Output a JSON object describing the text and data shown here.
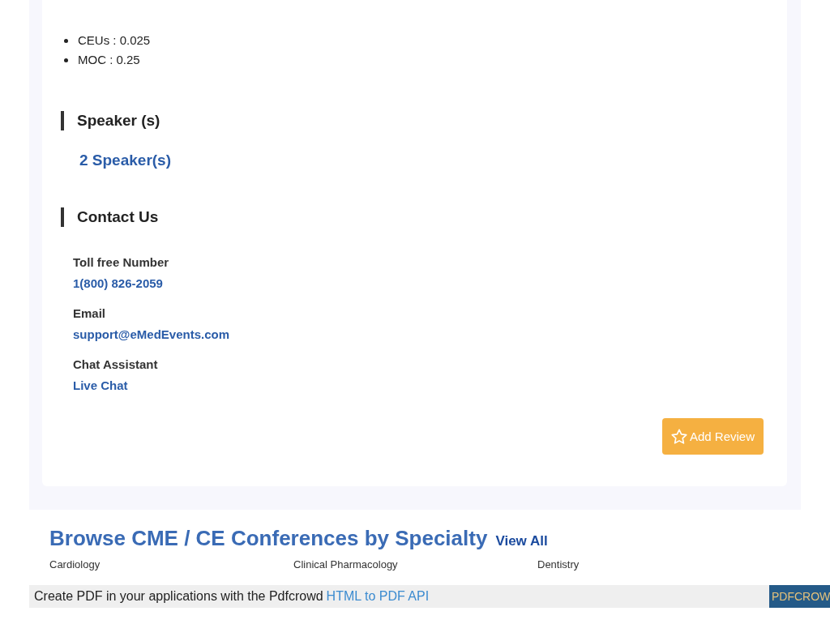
{
  "credits": [
    {
      "label": "CEUs : 0.025"
    },
    {
      "label": "MOC : 0.25"
    }
  ],
  "speakers": {
    "heading": "Speaker (s)",
    "link": "2 Speaker(s)"
  },
  "contact": {
    "heading": "Contact Us",
    "items": [
      {
        "label": "Toll free Number",
        "value": "1(800) 826-2059"
      },
      {
        "label": "Email",
        "value": "support@eMedEvents.com"
      },
      {
        "label": "Chat Assistant",
        "value": "Live Chat"
      }
    ]
  },
  "review_button": "Add Review",
  "browse": {
    "title": "Browse CME / CE Conferences by Specialty",
    "view_all": "View All",
    "specialties": [
      "Cardiology",
      "Clinical Pharmacology",
      "Dentistry"
    ]
  },
  "pdf_bar": {
    "text": "Create PDF in your applications with the Pdfcrowd",
    "link": "HTML to PDF API",
    "badge": "PDFCROW"
  }
}
